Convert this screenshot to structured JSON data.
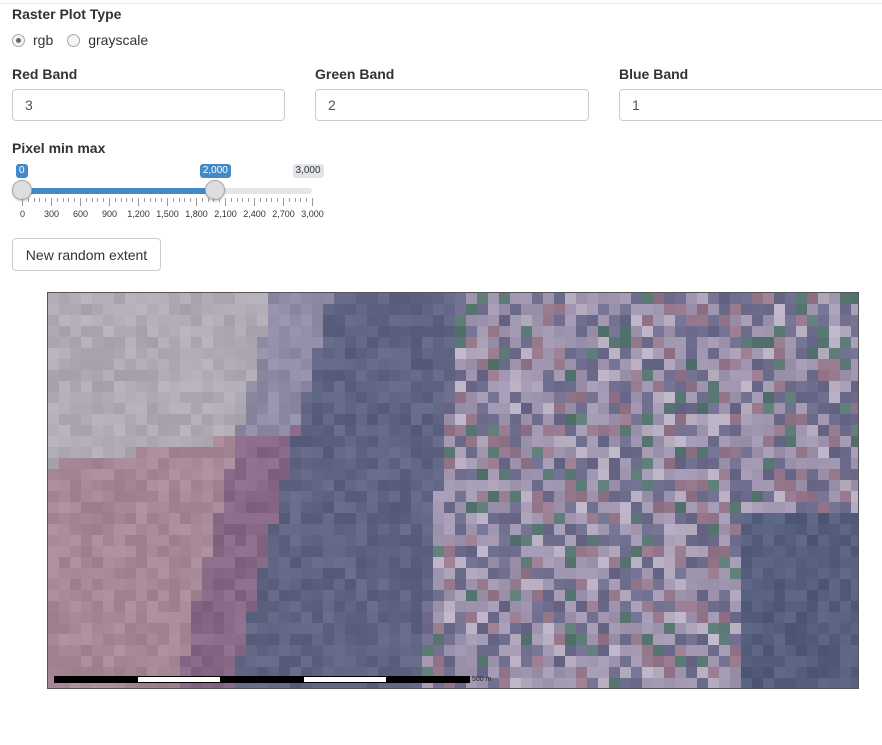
{
  "raster_plot_type": {
    "label": "Raster Plot Type",
    "options": [
      "rgb",
      "grayscale"
    ],
    "selected": "rgb"
  },
  "bands": {
    "red": {
      "label": "Red Band",
      "value": "3"
    },
    "green": {
      "label": "Green Band",
      "value": "2"
    },
    "blue": {
      "label": "Blue Band",
      "value": "1"
    }
  },
  "pixel_slider": {
    "label": "Pixel min max",
    "min_value": "0",
    "max_value": "2,000",
    "range_max": "3,000",
    "from": 0,
    "to": 2000,
    "range": [
      0,
      3000
    ],
    "tick_labels": [
      "0",
      "300",
      "600",
      "900",
      "1,200",
      "1,500",
      "1,800",
      "2,100",
      "2,400",
      "2,700",
      "3,000"
    ],
    "accent_color": "#428bca"
  },
  "random_extent_button": {
    "label": "New random extent"
  },
  "map": {
    "scale_label": "500 m"
  }
}
